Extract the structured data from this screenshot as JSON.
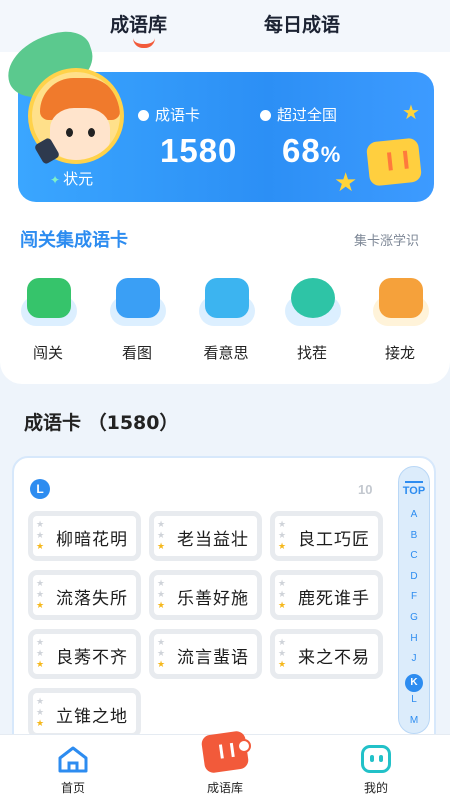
{
  "top_tabs": {
    "active": "成语库",
    "inactive": "每日成语"
  },
  "hero": {
    "rank": "状元",
    "stat1_label": "成语卡",
    "stat1_value": "1580",
    "stat2_label": "超过全国",
    "stat2_value": "68",
    "stat2_unit": "%"
  },
  "section": {
    "title": "闯关集成语卡",
    "link": "集卡涨学识"
  },
  "games": [
    {
      "label": "闯关",
      "icon": "star-flag-icon",
      "color": "#36c46b"
    },
    {
      "label": "看图",
      "icon": "landscape-icon",
      "color": "#3a9ff5"
    },
    {
      "label": "看意思",
      "icon": "scroll-icon",
      "color": "#3cb4f0"
    },
    {
      "label": "找茬",
      "icon": "magnifier-icon",
      "color": "#2ec4a6"
    },
    {
      "label": "接龙",
      "icon": "lock-chain-icon",
      "color": "#f5a13b"
    }
  ],
  "cards": {
    "title": "成语卡 （1580）",
    "letter": "L",
    "count": "10",
    "items": [
      {
        "text": "柳暗花明",
        "stars": 1
      },
      {
        "text": "老当益壮",
        "stars": 1
      },
      {
        "text": "良工巧匠",
        "stars": 1
      },
      {
        "text": "流落失所",
        "stars": 1
      },
      {
        "text": "乐善好施",
        "stars": 1
      },
      {
        "text": "鹿死谁手",
        "stars": 1
      },
      {
        "text": "良莠不齐",
        "stars": 1
      },
      {
        "text": "流言蜚语",
        "stars": 1
      },
      {
        "text": "来之不易",
        "stars": 1
      },
      {
        "text": "立锥之地",
        "stars": 1
      }
    ]
  },
  "alphabet": {
    "top": "TOP",
    "letters": [
      "A",
      "B",
      "C",
      "D",
      "F",
      "G",
      "H",
      "J",
      "K",
      "L",
      "M"
    ],
    "active": "K"
  },
  "bottom_nav": [
    {
      "label": "首页",
      "icon": "home-icon"
    },
    {
      "label": "成语库",
      "icon": "idiom-cards-icon"
    },
    {
      "label": "我的",
      "icon": "robot-face-icon"
    }
  ],
  "colors": {
    "accent": "#2d8cf0",
    "active_tab": "#f25a3a",
    "star_gold": "#f5b81d"
  }
}
